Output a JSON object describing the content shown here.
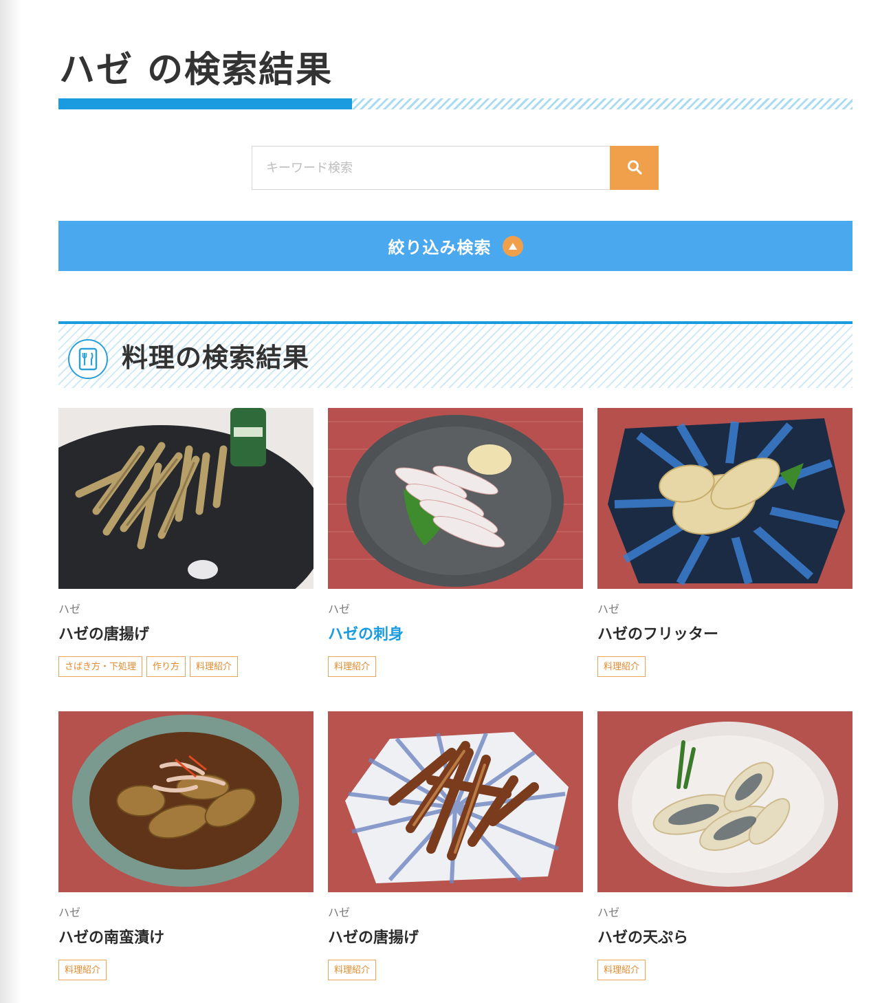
{
  "header": {
    "title": "ハゼ の検索結果"
  },
  "search": {
    "placeholder": "キーワード検索",
    "value": ""
  },
  "filter": {
    "label": "絞り込み検索"
  },
  "results_section": {
    "title": "料理の検索結果"
  },
  "colors": {
    "accent_blue": "#1a9be0",
    "filter_blue": "#4aa8ef",
    "accent_orange": "#f0a04b",
    "tag_orange": "#e28a2c"
  },
  "cards": [
    {
      "category": "ハゼ",
      "title": "ハゼの唐揚げ",
      "tags": [
        "さばき方・下処理",
        "作り方",
        "料理紹介"
      ],
      "image": "fried-goby-dark-plate-photo"
    },
    {
      "category": "ハゼ",
      "title": "ハゼの刺身",
      "tags": [
        "料理紹介"
      ],
      "image": "goby-sashimi-gray-plate-photo"
    },
    {
      "category": "ハゼ",
      "title": "ハゼのフリッター",
      "tags": [
        "料理紹介"
      ],
      "image": "goby-fritter-blue-plate-photo"
    },
    {
      "category": "ハゼ",
      "title": "ハゼの南蛮漬け",
      "tags": [
        "料理紹介"
      ],
      "image": "goby-nanban-bowl-photo"
    },
    {
      "category": "ハゼ",
      "title": "ハゼの唐揚げ",
      "tags": [
        "料理紹介"
      ],
      "image": "glazed-goby-striped-plate-photo"
    },
    {
      "category": "ハゼ",
      "title": "ハゼの天ぷら",
      "tags": [
        "料理紹介"
      ],
      "image": "goby-tempura-white-plate-photo"
    }
  ]
}
